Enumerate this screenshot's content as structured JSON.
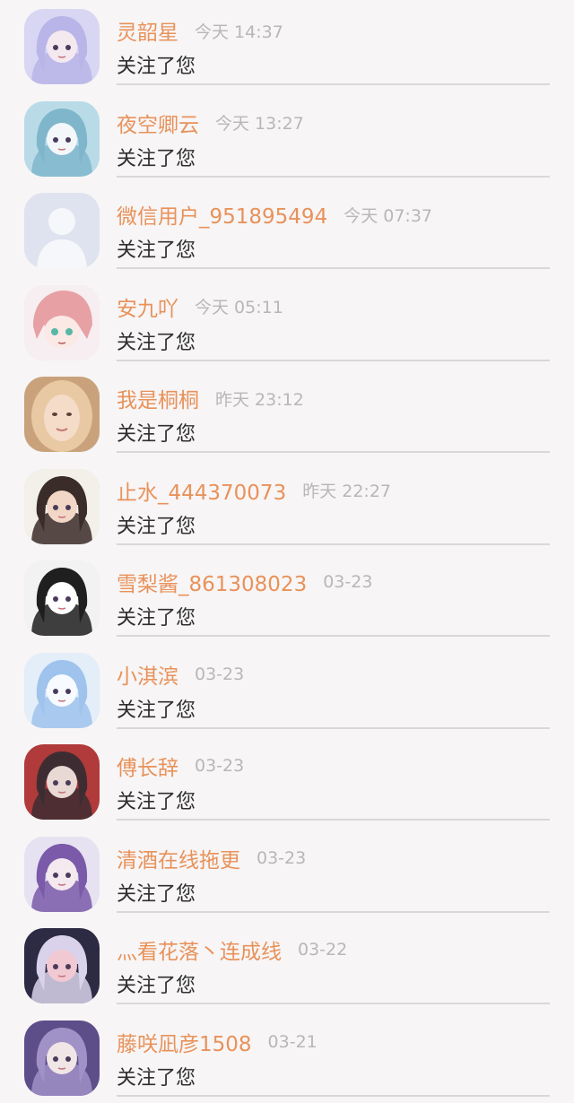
{
  "notifications": [
    {
      "name": "灵韶星",
      "time": "今天 14:37",
      "message": "关注了您",
      "avatar": "anime-girl-silver-hair-avatar",
      "palette": [
        "#d8d6f2",
        "#b9b5e8",
        "#f5e9f0"
      ]
    },
    {
      "name": "夜空卿云",
      "time": "今天 13:27",
      "message": "关注了您",
      "avatar": "anime-girl-blue-scene-avatar",
      "palette": [
        "#b9dbe8",
        "#7fb6cc",
        "#f3f7fa"
      ]
    },
    {
      "name": "微信用户_951895494",
      "time": "今天 07:37",
      "message": "关注了您",
      "avatar": "default-user-silhouette-avatar",
      "palette": [
        "#dfe3ef",
        "#c4cbe0",
        "#eef0f6"
      ]
    },
    {
      "name": "安九吖",
      "time": "今天 05:11",
      "message": "关注了您",
      "avatar": "anime-pink-hair-avatar",
      "palette": [
        "#f6eef0",
        "#e7a0a4",
        "#ffffff"
      ]
    },
    {
      "name": "我是桐桐",
      "time": "昨天 23:12",
      "message": "关注了您",
      "avatar": "photo-blonde-girl-avatar",
      "palette": [
        "#c9a27c",
        "#e8c9a3",
        "#f4dcc9"
      ]
    },
    {
      "name": "止水_444370073",
      "time": "昨天 22:27",
      "message": "关注了您",
      "avatar": "anime-dark-hair-girl-avatar",
      "palette": [
        "#f3efe9",
        "#3a2c28",
        "#f3d7c6"
      ]
    },
    {
      "name": "雪梨酱_861308023",
      "time": "03-23",
      "message": "关注了您",
      "avatar": "anime-black-twintails-avatar",
      "palette": [
        "#f2f2f2",
        "#1f1f1f",
        "#ffffff"
      ]
    },
    {
      "name": "小淇滨",
      "time": "03-23",
      "message": "关注了您",
      "avatar": "anime-light-blue-hair-avatar",
      "palette": [
        "#e3eef9",
        "#9fc3ec",
        "#f7fbff"
      ]
    },
    {
      "name": "傅长辞",
      "time": "03-23",
      "message": "关注了您",
      "avatar": "anime-red-robe-avatar",
      "palette": [
        "#b13a3a",
        "#3d2d33",
        "#e9d9d4"
      ]
    },
    {
      "name": "清酒在线拖更",
      "time": "03-23",
      "message": "关注了您",
      "avatar": "anime-purple-hair-avatar",
      "palette": [
        "#e7e2f1",
        "#7a5aa9",
        "#f3e9ee"
      ]
    },
    {
      "name": "灬看花落丶连成线",
      "time": "03-22",
      "message": "关注了您",
      "avatar": "anime-fox-ears-avatar",
      "palette": [
        "#2d2a44",
        "#d9d2ea",
        "#f1c9d2"
      ]
    },
    {
      "name": "藤咲凪彦1508",
      "time": "03-21",
      "message": "关注了您",
      "avatar": "anime-purple-haired-boy-avatar",
      "palette": [
        "#5d4e8a",
        "#a091c7",
        "#f1e6e6"
      ]
    }
  ]
}
